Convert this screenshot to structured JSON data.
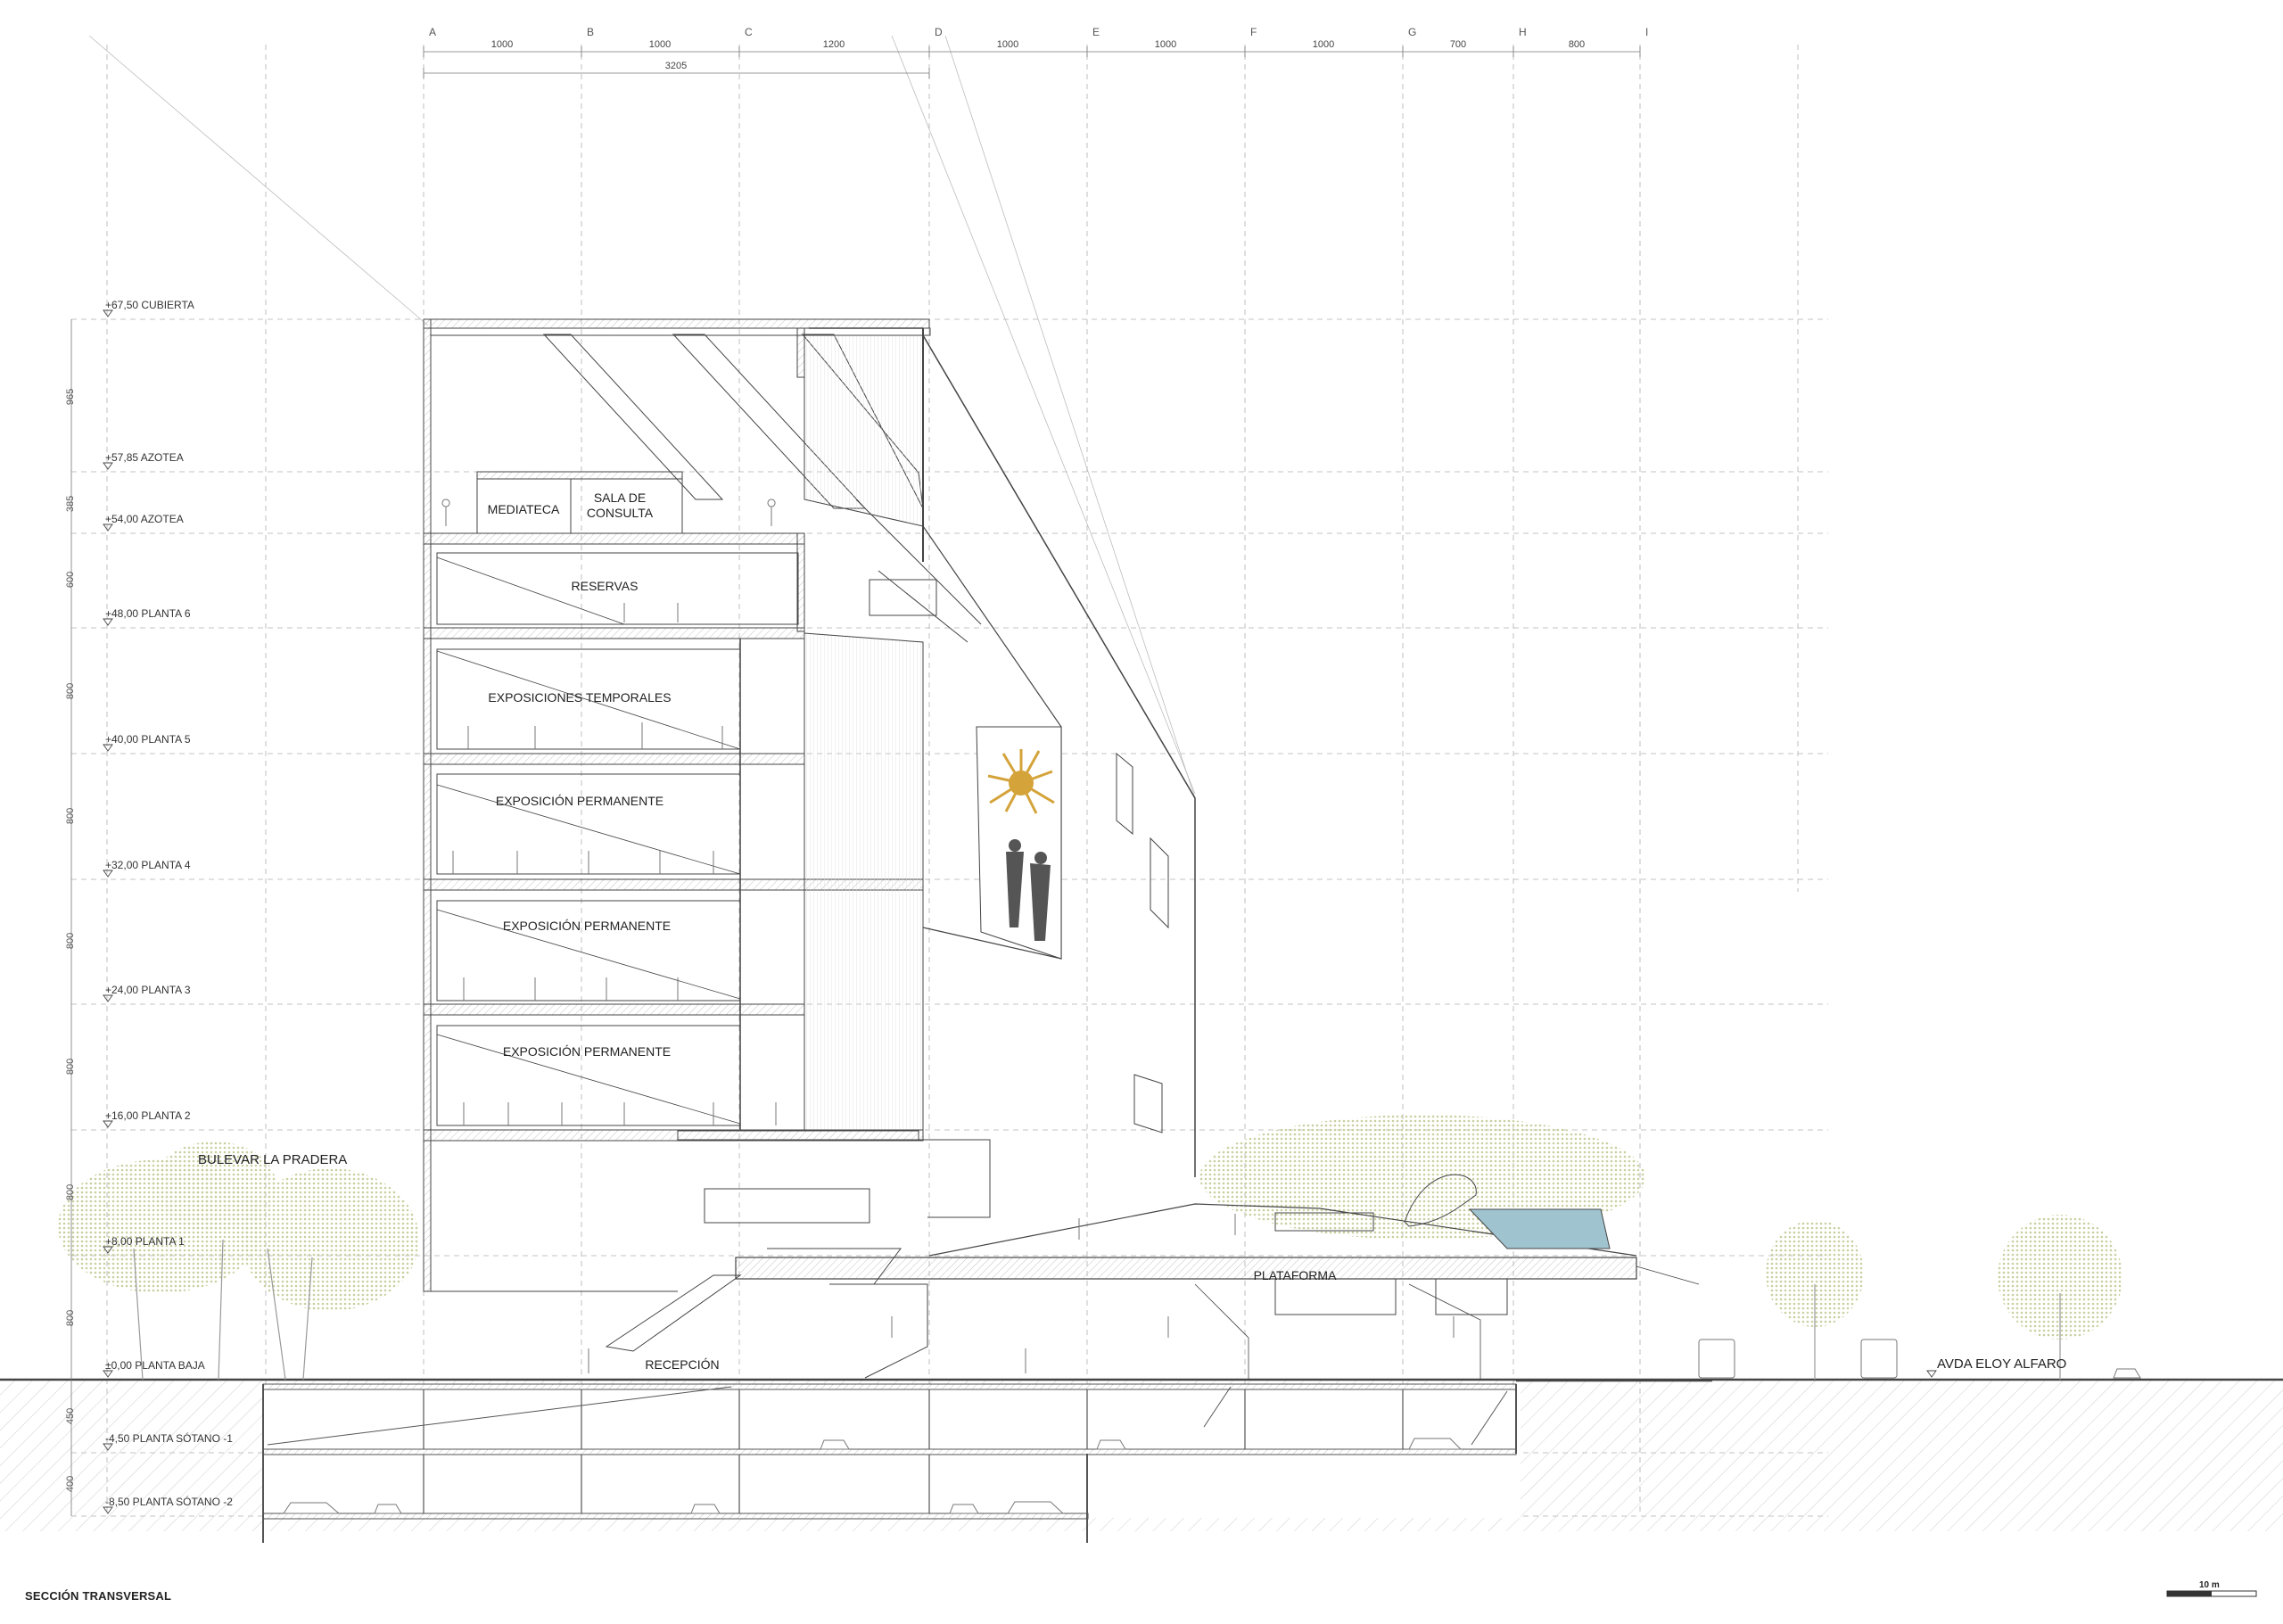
{
  "sheet_title": "SECCIÓN TRANSVERSAL",
  "scale_label": "10 m",
  "grid_axes": [
    {
      "id": "A",
      "span": "1000"
    },
    {
      "id": "B",
      "span": "1000"
    },
    {
      "id": "C",
      "span": "1200"
    },
    {
      "id": "D",
      "span": "1000"
    },
    {
      "id": "E",
      "span": "1000"
    },
    {
      "id": "F",
      "span": "1000"
    },
    {
      "id": "G",
      "span": "700"
    },
    {
      "id": "H",
      "span": "800"
    },
    {
      "id": "I",
      "span": ""
    }
  ],
  "overall_dimension": "3205",
  "levels": [
    {
      "label": "+67,50  CUBIERTA",
      "height_above": ""
    },
    {
      "label": "+57,85  AZOTEA",
      "height_above": "965"
    },
    {
      "label": "+54,00  AZOTEA",
      "height_above": "385"
    },
    {
      "label": "+48,00  PLANTA 6",
      "height_above": "600"
    },
    {
      "label": "+40,00  PLANTA 5",
      "height_above": "800"
    },
    {
      "label": "+32,00  PLANTA 4",
      "height_above": "800"
    },
    {
      "label": "+24,00  PLANTA 3",
      "height_above": "800"
    },
    {
      "label": "+16,00  PLANTA 2",
      "height_above": "800"
    },
    {
      "label": "+8,00  PLANTA 1",
      "height_above": "800"
    },
    {
      "label": "±0,00  PLANTA BAJA",
      "height_above": "800"
    },
    {
      "label": "-4,50  PLANTA SÓTANO  -1",
      "height_above": "450"
    },
    {
      "label": "-8,50  PLANTA SÓTANO  -2",
      "height_above": "400"
    }
  ],
  "rooms": {
    "mediateca": "MEDIATECA",
    "sala_line1": "SALA DE",
    "sala_line2": "CONSULTA",
    "reservas": "RESERVAS",
    "temporales": "EXPOSICIONES TEMPORALES",
    "permanente_4": "EXPOSICIÓN PERMANENTE",
    "permanente_3": "EXPOSICIÓN PERMANENTE",
    "permanente_2": "EXPOSICIÓN PERMANENTE",
    "plataforma": "PLATAFORMA",
    "recepcion": "RECEPCIÓN"
  },
  "streets": {
    "west": "BULEVAR  LA PRADERA",
    "east": "AVDA ELOY ALFARO"
  },
  "colors": {
    "line": "#555555",
    "grid": "#9a9a9a",
    "tree": "#c9cf9f",
    "pool": "#9fc3cf",
    "sun": "#d4a33a",
    "figure": "#555555"
  }
}
